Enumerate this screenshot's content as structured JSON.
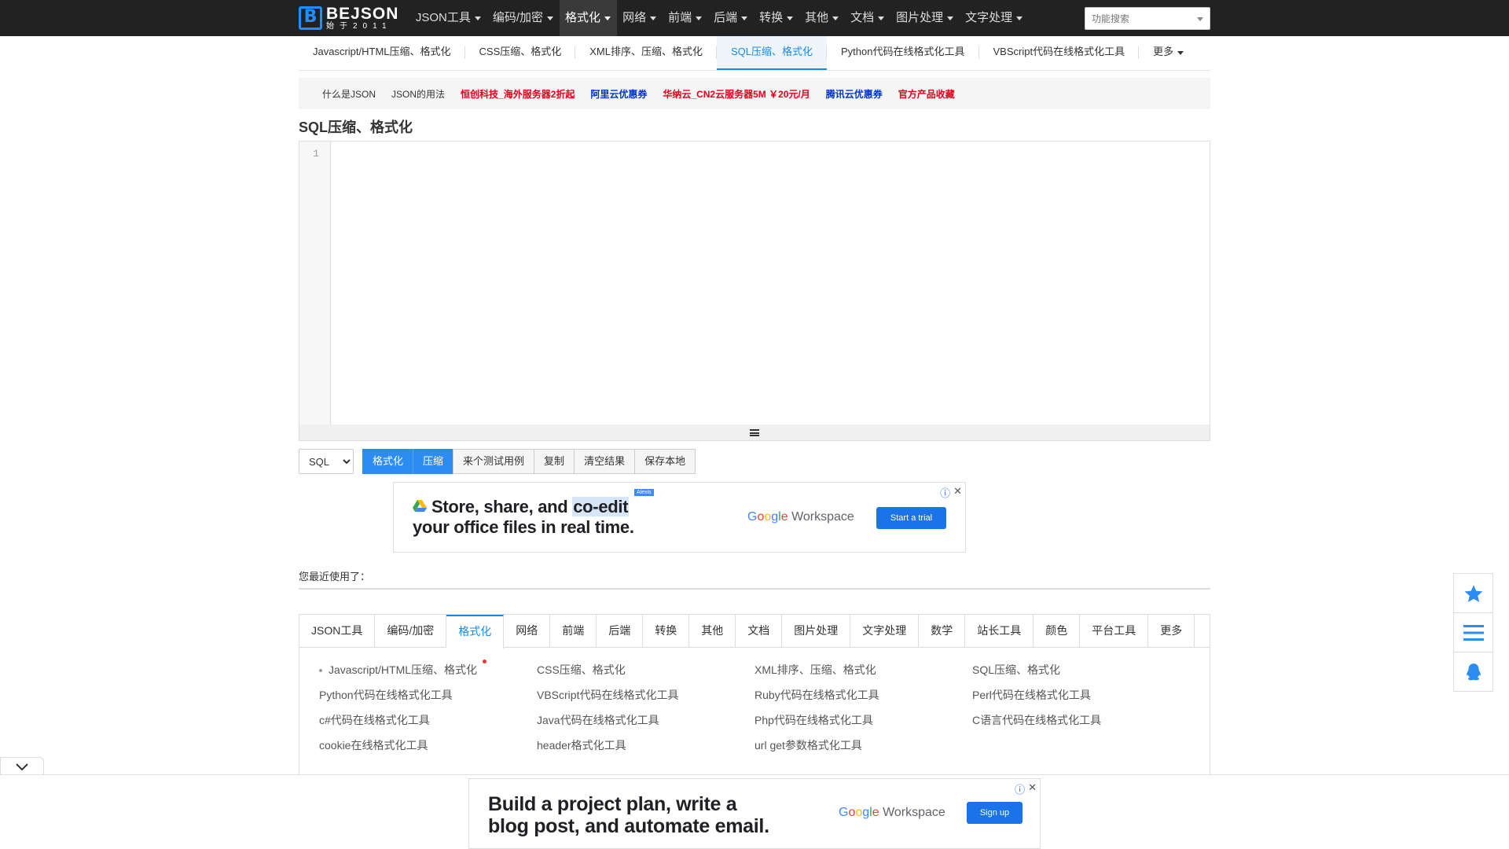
{
  "logo": {
    "name": "BEJSON",
    "sub": "始于2011",
    "mark": "B"
  },
  "nav": {
    "items": [
      {
        "label": "JSON工具",
        "active": false
      },
      {
        "label": "编码/加密",
        "active": false
      },
      {
        "label": "格式化",
        "active": true
      },
      {
        "label": "网络",
        "active": false
      },
      {
        "label": "前端",
        "active": false
      },
      {
        "label": "后端",
        "active": false
      },
      {
        "label": "转换",
        "active": false
      },
      {
        "label": "其他",
        "active": false
      },
      {
        "label": "文档",
        "active": false
      },
      {
        "label": "图片处理",
        "active": false
      },
      {
        "label": "文字处理",
        "active": false
      }
    ],
    "search_placeholder": "功能搜索"
  },
  "subtabs": [
    {
      "label": "Javascript/HTML压缩、格式化",
      "active": false
    },
    {
      "label": "CSS压缩、格式化",
      "active": false
    },
    {
      "label": "XML排序、压缩、格式化",
      "active": false
    },
    {
      "label": "SQL压缩、格式化",
      "active": true
    },
    {
      "label": "Python代码在线格式化工具",
      "active": false
    },
    {
      "label": "VBScript代码在线格式化工具",
      "active": false
    },
    {
      "label": "更多",
      "active": false
    }
  ],
  "linkbar": [
    {
      "label": "什么是JSON",
      "style": "plain"
    },
    {
      "label": "JSON的用法",
      "style": "plain"
    },
    {
      "label": "恒创科技_海外服务器2折起",
      "style": "red"
    },
    {
      "label": "阿里云优惠券",
      "style": "blue"
    },
    {
      "label": "华纳云_CN2云服务器5M ￥20元/月",
      "style": "red"
    },
    {
      "label": "腾讯云优惠券",
      "style": "blue"
    },
    {
      "label": "官方产品收藏",
      "style": "red"
    }
  ],
  "page_title": "SQL压缩、格式化",
  "editor": {
    "line_number": "1"
  },
  "toolbar": {
    "language": "SQL",
    "language_options": [
      "SQL"
    ],
    "format_label": "格式化",
    "compress_label": "压缩",
    "sample_label": "来个测试用例",
    "copy_label": "复制",
    "clear_label": "清空结果",
    "save_label": "保存本地"
  },
  "ad_top": {
    "line1_pre": "Store, share, and ",
    "line1_hl": "co-edit",
    "line2": "your office files in real time.",
    "tag": "Alexis",
    "brand_google": "Google",
    "brand_product": "Workspace",
    "cta": "Start a trial"
  },
  "recent_label": "您最近使用了：",
  "categories": {
    "tabs": [
      {
        "label": "JSON工具",
        "active": false
      },
      {
        "label": "编码/加密",
        "active": false
      },
      {
        "label": "格式化",
        "active": true
      },
      {
        "label": "网络",
        "active": false
      },
      {
        "label": "前端",
        "active": false
      },
      {
        "label": "后端",
        "active": false
      },
      {
        "label": "转换",
        "active": false
      },
      {
        "label": "其他",
        "active": false
      },
      {
        "label": "文档",
        "active": false
      },
      {
        "label": "图片处理",
        "active": false
      },
      {
        "label": "文字处理",
        "active": false
      },
      {
        "label": "数学",
        "active": false
      },
      {
        "label": "站长工具",
        "active": false
      },
      {
        "label": "颜色",
        "active": false
      },
      {
        "label": "平台工具",
        "active": false
      },
      {
        "label": "更多",
        "active": false
      }
    ],
    "links": [
      "Javascript/HTML压缩、格式化",
      "CSS压缩、格式化",
      "XML排序、压缩、格式化",
      "SQL压缩、格式化",
      "Python代码在线格式化工具",
      "VBScript代码在线格式化工具",
      "Ruby代码在线格式化工具",
      "Perl代码在线格式化工具",
      "c#代码在线格式化工具",
      "Java代码在线格式化工具",
      "Php代码在线格式化工具",
      "C语言代码在线格式化工具",
      "cookie在线格式化工具",
      "header格式化工具",
      "url get参数格式化工具"
    ]
  },
  "ad_bottom": {
    "line1": "Build a project plan, write a",
    "line2": "blog post, and automate email.",
    "brand_google": "Google",
    "brand_product": "Workspace",
    "cta": "Sign up"
  },
  "colors": {
    "accent": "#1e88e5",
    "nav_bg": "#222222",
    "primary_btn": "#2d8cf0",
    "link_red": "#e3001b",
    "link_blue": "#0033cc"
  },
  "icons": {
    "side": [
      "star-icon",
      "list-icon",
      "qq-icon"
    ],
    "collapse": "chevron-down-icon"
  }
}
